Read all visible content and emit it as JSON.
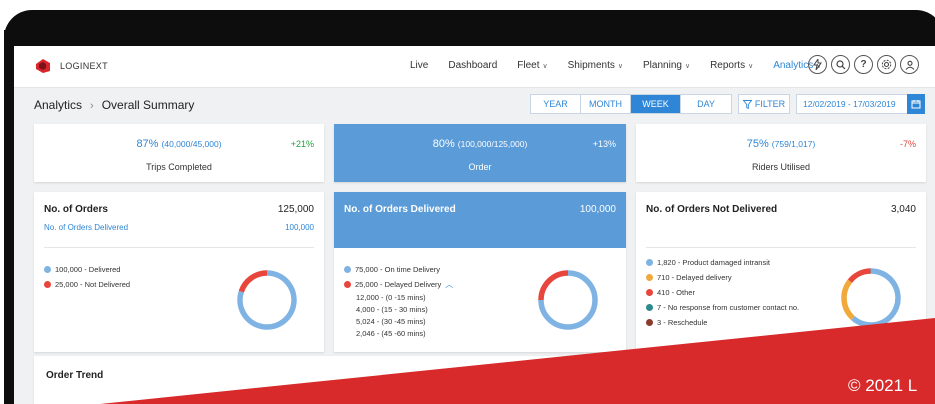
{
  "brand": {
    "name": "LOGINEXT"
  },
  "nav": {
    "items": [
      {
        "label": "Live",
        "has_menu": false,
        "active": false
      },
      {
        "label": "Dashboard",
        "has_menu": false,
        "active": false
      },
      {
        "label": "Fleet",
        "has_menu": true,
        "active": false
      },
      {
        "label": "Shipments",
        "has_menu": true,
        "active": false
      },
      {
        "label": "Planning",
        "has_menu": true,
        "active": false
      },
      {
        "label": "Reports",
        "has_menu": true,
        "active": false
      },
      {
        "label": "Analytics",
        "has_menu": true,
        "active": true
      }
    ],
    "icons": [
      "bolt-icon",
      "search-icon",
      "help-icon",
      "settings-icon",
      "user-icon"
    ]
  },
  "breadcrumb": {
    "root": "Analytics",
    "current": "Overall Summary"
  },
  "period_tabs": [
    {
      "label": "YEAR",
      "active": false
    },
    {
      "label": "MONTH",
      "active": false
    },
    {
      "label": "WEEK",
      "active": true
    },
    {
      "label": "DAY",
      "active": false
    }
  ],
  "filter": {
    "label": "FILTER"
  },
  "date_range": "12/02/2019 - 17/03/2019",
  "kpis": {
    "trips": {
      "percent": "87%",
      "detail": "(40,000/45,000)",
      "label": "Trips Completed",
      "change": "+21%"
    },
    "order": {
      "percent": "80%",
      "detail": "(100,000/125,000)",
      "label": "Order",
      "change": "+13%"
    },
    "riders": {
      "percent": "75%",
      "detail": "(759/1,017)",
      "label": "Riders Utilised",
      "change": "-7%"
    }
  },
  "orders": {
    "title": "No. of Orders",
    "total": "125,000",
    "sub_label": "No. of Orders Delivered",
    "sub_value": "100,000",
    "legend": [
      {
        "label": "100,000 - Delivered",
        "color": "#7fb3e3",
        "value": 100000
      },
      {
        "label": "25,000 - Not Delivered",
        "color": "#e8463c",
        "value": 25000
      }
    ]
  },
  "delivered": {
    "title": "No. of Orders Delivered",
    "total": "100,000",
    "legend": [
      {
        "label": "75,000 - On time Delivery",
        "color": "#7fb3e3",
        "value": 75000
      },
      {
        "label": "25,000 - Delayed Delivery",
        "color": "#e8463c",
        "value": 25000
      }
    ],
    "delay_breakdown": [
      "12,000 - (0 -15 mins)",
      "4,000 - (15 - 30 mins)",
      "5,024 - (30 -45 mins)",
      "2,046 - (45 -60 mins)"
    ]
  },
  "not_delivered": {
    "title": "No. of Orders Not Delivered",
    "total": "3,040",
    "legend": [
      {
        "label": "1,820 - Product damaged intransit",
        "color": "#7fb3e3",
        "value": 1820
      },
      {
        "label": "710 - Delayed delivery",
        "color": "#f0a93a",
        "value": 710
      },
      {
        "label": "410 - Other",
        "color": "#e8463c",
        "value": 410
      },
      {
        "label": "7 - No response from customer contact no.",
        "color": "#2e8b8b",
        "value": 7
      },
      {
        "label": "3 - Reschedule",
        "color": "#8b3a2e",
        "value": 3
      }
    ]
  },
  "trend": {
    "title": "Order Trend"
  },
  "footer": {
    "copyright": "© 2021 L"
  },
  "colors": {
    "accent": "#2f86d6",
    "card_blue": "#5a9bd8",
    "banner_red": "#d82a2a"
  }
}
